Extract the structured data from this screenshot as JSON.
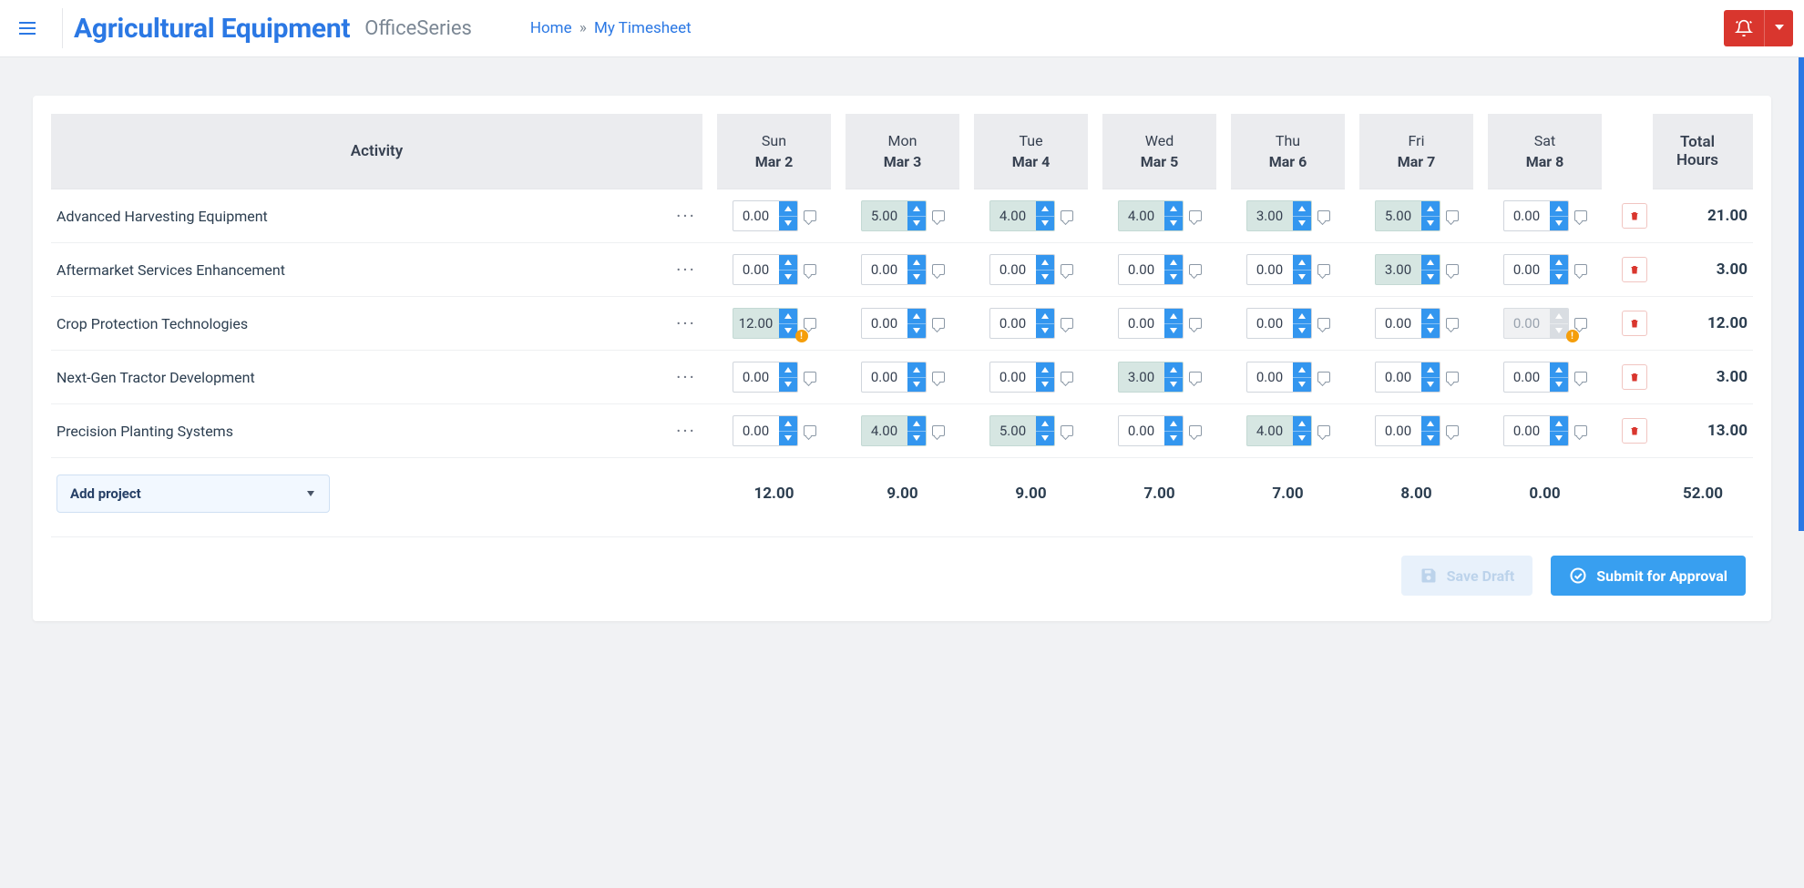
{
  "header": {
    "brand_title": "Agricultural Equipment",
    "brand_sub": "OfficeSeries",
    "breadcrumb_home": "Home",
    "breadcrumb_sep": "»",
    "breadcrumb_current": "My Timesheet"
  },
  "table": {
    "col_activity": "Activity",
    "col_total": "Total Hours",
    "days": [
      {
        "dow": "Sun",
        "date": "Mar 2"
      },
      {
        "dow": "Mon",
        "date": "Mar 3"
      },
      {
        "dow": "Tue",
        "date": "Mar 4"
      },
      {
        "dow": "Wed",
        "date": "Mar 5"
      },
      {
        "dow": "Thu",
        "date": "Mar 6"
      },
      {
        "dow": "Fri",
        "date": "Mar 7"
      },
      {
        "dow": "Sat",
        "date": "Mar 8"
      }
    ],
    "rows": [
      {
        "name": "Advanced Harvesting Equipment",
        "cells": [
          {
            "v": "0.00",
            "filled": false
          },
          {
            "v": "5.00",
            "filled": true
          },
          {
            "v": "4.00",
            "filled": true
          },
          {
            "v": "4.00",
            "filled": true
          },
          {
            "v": "3.00",
            "filled": true
          },
          {
            "v": "5.00",
            "filled": true
          },
          {
            "v": "0.00",
            "filled": false
          }
        ],
        "total": "21.00"
      },
      {
        "name": "Aftermarket Services Enhancement",
        "cells": [
          {
            "v": "0.00",
            "filled": false
          },
          {
            "v": "0.00",
            "filled": false
          },
          {
            "v": "0.00",
            "filled": false
          },
          {
            "v": "0.00",
            "filled": false
          },
          {
            "v": "0.00",
            "filled": false
          },
          {
            "v": "3.00",
            "filled": true
          },
          {
            "v": "0.00",
            "filled": false
          }
        ],
        "total": "3.00"
      },
      {
        "name": "Crop Protection Technologies",
        "cells": [
          {
            "v": "12.00",
            "filled": true,
            "warn": true
          },
          {
            "v": "0.00",
            "filled": false
          },
          {
            "v": "0.00",
            "filled": false
          },
          {
            "v": "0.00",
            "filled": false
          },
          {
            "v": "0.00",
            "filled": false
          },
          {
            "v": "0.00",
            "filled": false
          },
          {
            "v": "0.00",
            "filled": false,
            "disabled": true,
            "warn": true
          }
        ],
        "total": "12.00"
      },
      {
        "name": "Next-Gen Tractor Development",
        "cells": [
          {
            "v": "0.00",
            "filled": false
          },
          {
            "v": "0.00",
            "filled": false
          },
          {
            "v": "0.00",
            "filled": false
          },
          {
            "v": "3.00",
            "filled": true
          },
          {
            "v": "0.00",
            "filled": false
          },
          {
            "v": "0.00",
            "filled": false
          },
          {
            "v": "0.00",
            "filled": false
          }
        ],
        "total": "3.00"
      },
      {
        "name": "Precision Planting Systems",
        "cells": [
          {
            "v": "0.00",
            "filled": false
          },
          {
            "v": "4.00",
            "filled": true
          },
          {
            "v": "5.00",
            "filled": true
          },
          {
            "v": "0.00",
            "filled": false
          },
          {
            "v": "4.00",
            "filled": true
          },
          {
            "v": "0.00",
            "filled": false
          },
          {
            "v": "0.00",
            "filled": false
          }
        ],
        "total": "13.00"
      }
    ],
    "day_totals": [
      "12.00",
      "9.00",
      "9.00",
      "7.00",
      "7.00",
      "8.00",
      "0.00"
    ],
    "grand_total": "52.00",
    "add_project_label": "Add project"
  },
  "actions": {
    "save_draft": "Save Draft",
    "submit": "Submit for Approval"
  }
}
